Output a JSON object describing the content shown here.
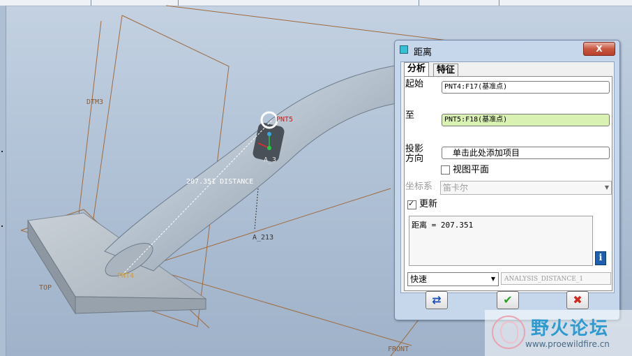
{
  "viewport": {
    "datum_labels": {
      "dtm3": "DTM3",
      "top": "TOP",
      "front": "FRONT",
      "a213": "A_213",
      "pnt5": "PNT5",
      "pnt4": "PNT4",
      "a3": "A_3"
    },
    "distance_callout": "207.351  DISTANCE"
  },
  "dialog": {
    "title": "距离",
    "close_label": "X",
    "tabs": [
      {
        "label": "分析",
        "active": true
      },
      {
        "label": "特征",
        "active": false
      }
    ],
    "from": {
      "label": "起始",
      "value": "PNT4:F17(基准点)"
    },
    "to": {
      "label": "至",
      "value": "PNT5:F18(基准点)"
    },
    "projection": {
      "label": "投影方向",
      "label_line1": "投影",
      "label_line2": "方向",
      "value": "单击此处添加项目"
    },
    "view_plane": {
      "label": "视图平面",
      "checked": false
    },
    "coord_system": {
      "label": "坐标系",
      "value": "笛卡尔"
    },
    "update": {
      "label": "更新",
      "checked": true
    },
    "result_text": "距离 = 207.351",
    "mode": {
      "value": "快速"
    },
    "analysis_name": "ANALYSIS_DISTANCE_1"
  },
  "watermark": {
    "title": "野火论坛",
    "url": "www.proewildfire.cn"
  },
  "colors": {
    "datum_line": "#a06a3c",
    "field_highlight": "#daf1b4",
    "ok_green": "#2aa02a",
    "cancel_red": "#d22a1a"
  }
}
